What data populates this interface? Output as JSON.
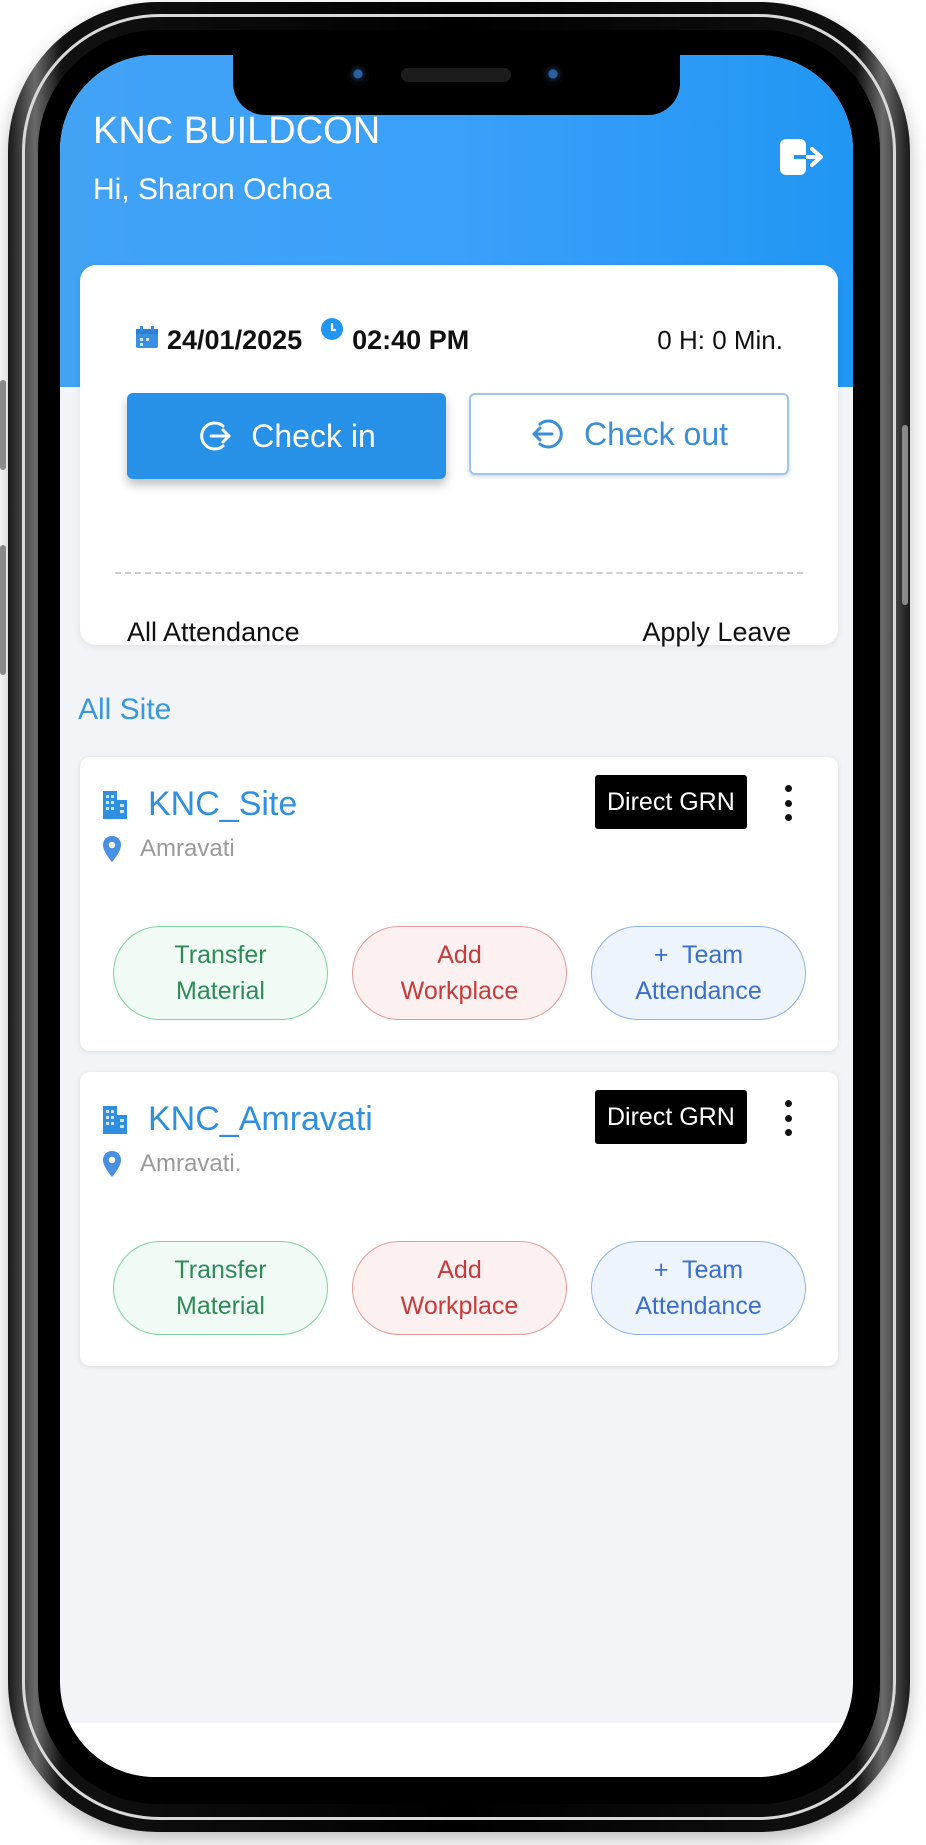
{
  "header": {
    "app_title": "KNC BUILDCON",
    "greeting": "Hi, Sharon Ochoa",
    "logout_icon": "logout-icon"
  },
  "attendance": {
    "date_icon": "calendar-icon",
    "date": "24/01/2025",
    "time_icon": "clock-icon",
    "time": "02:40 PM",
    "hours_worked": "0 H: 0 Min.",
    "check_in_label": "Check in",
    "check_out_label": "Check out",
    "all_attendance_label": "All Attendance",
    "apply_leave_label": "Apply Leave"
  },
  "sites_section": {
    "title": "All Site",
    "sites": [
      {
        "name": "KNC_Site",
        "location": "Amravati",
        "badge": "Direct GRN",
        "actions": {
          "transfer_line1": "Transfer",
          "transfer_line2": "Material",
          "workplace_line1": "Add",
          "workplace_line2": "Workplace",
          "team_line1": "+  Team",
          "team_line2": "Attendance"
        }
      },
      {
        "name": "KNC_Amravati",
        "location": "Amravati.",
        "badge": "Direct GRN",
        "actions": {
          "transfer_line1": "Transfer",
          "transfer_line2": "Material",
          "workplace_line1": "Add",
          "workplace_line2": "Workplace",
          "team_line1": "+  Team",
          "team_line2": "Attendance"
        }
      }
    ]
  },
  "colors": {
    "primary": "#2196f3",
    "link_blue": "#2f8fe0",
    "green": "#2e8b57",
    "red": "#c93a3a",
    "blue_pill": "#3a6fd0",
    "badge_bg": "#000000"
  }
}
